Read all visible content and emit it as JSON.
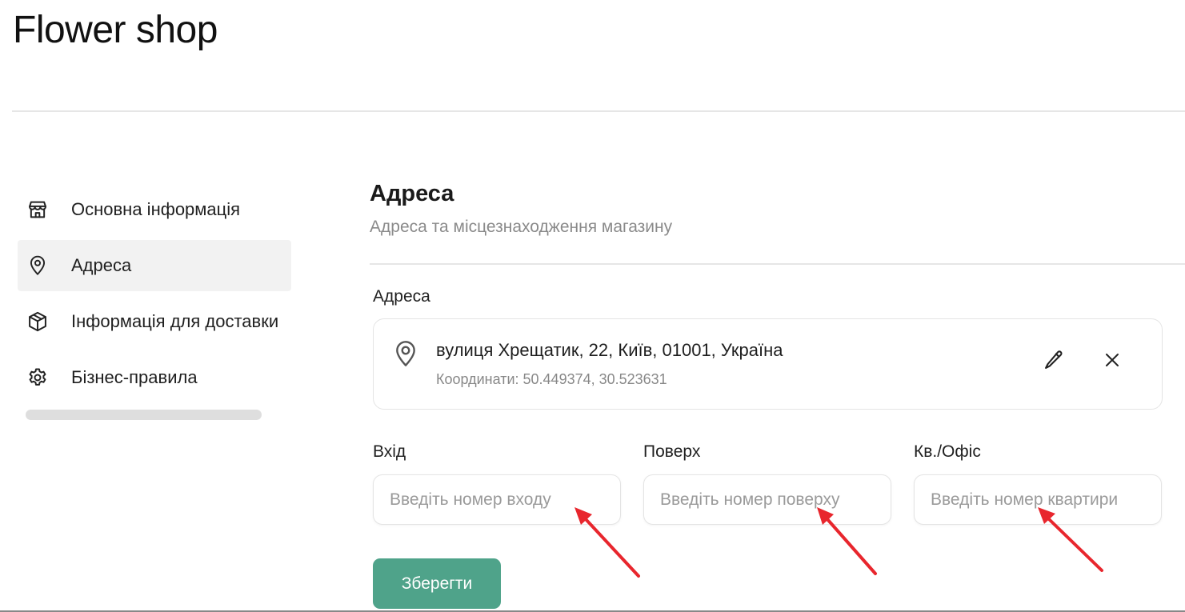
{
  "app": {
    "title": "Flower shop"
  },
  "sidebar": {
    "items": [
      {
        "label": "Основна інформація",
        "icon": "store-icon",
        "active": false
      },
      {
        "label": "Адреса",
        "icon": "location-pin-icon",
        "active": true
      },
      {
        "label": "Інформація для доставки",
        "icon": "package-icon",
        "active": false
      },
      {
        "label": "Бізнес-правила",
        "icon": "gear-icon",
        "active": false
      }
    ]
  },
  "main": {
    "section_title": "Адреса",
    "section_subtitle": "Адреса та місцезнаходження магазину",
    "address": {
      "label": "Адреса",
      "value": "вулиця Хрещатик, 22, Київ, 01001, Україна",
      "coordinates": "Координати: 50.449374, 30.523631",
      "icon": "location-pin-icon",
      "edit_icon": "pencil-icon",
      "clear_icon": "close-icon"
    },
    "fields": {
      "entrance": {
        "label": "Вхід",
        "value": "",
        "placeholder": "Введіть номер входу"
      },
      "floor": {
        "label": "Поверх",
        "value": "",
        "placeholder": "Введіть номер поверху"
      },
      "apartment": {
        "label": "Кв./Офіс",
        "value": "",
        "placeholder": "Введіть номер квартири"
      }
    },
    "save_label": "Зберегти"
  },
  "colors": {
    "accent": "#4fa38a",
    "active_item_bg": "#f2f2f2",
    "annotation_arrow": "#e8262d"
  }
}
